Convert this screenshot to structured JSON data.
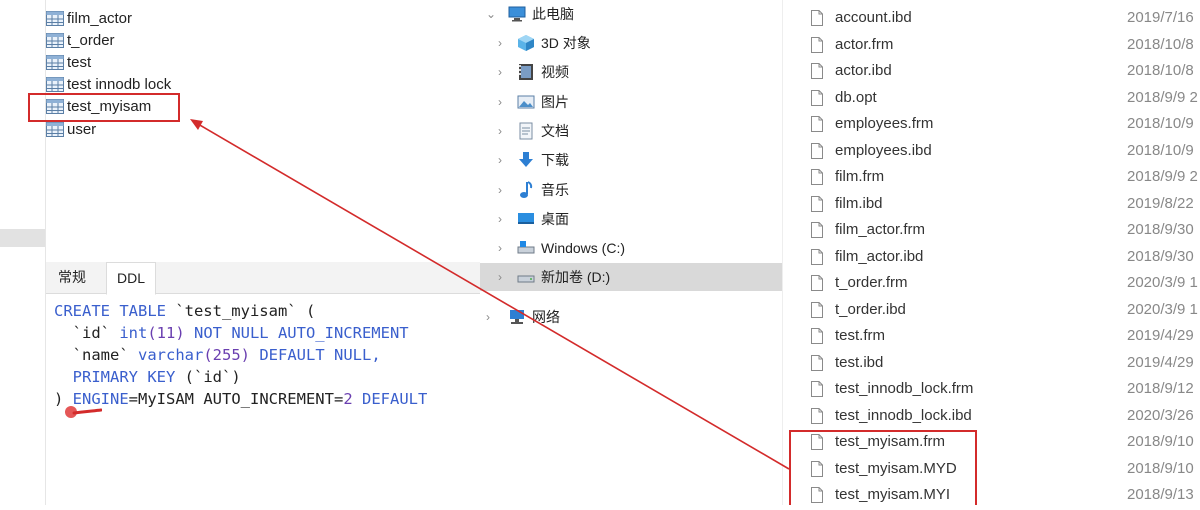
{
  "table_list": {
    "items": [
      {
        "label": "film_actor"
      },
      {
        "label": "t_order"
      },
      {
        "label": "test"
      },
      {
        "label": "test innodb lock"
      },
      {
        "label": "test_myisam"
      },
      {
        "label": "user"
      }
    ]
  },
  "tabs": [
    {
      "label": "常规"
    },
    {
      "label": "DDL"
    }
  ],
  "ddl": {
    "line1_kw": "CREATE TABLE",
    "line1_name": " `test_myisam` (",
    "line2_a": "  `id` ",
    "line2_type": "int",
    "line2_num": "(11)",
    "line2_kw": " NOT NULL AUTO_INCREMENT",
    "line3_a": "  `name` ",
    "line3_type": "varchar",
    "line3_num": "(255)",
    "line3_kw": " DEFAULT NULL,",
    "line4_kw": "  PRIMARY KEY",
    "line4_b": " (`id`)",
    "line5_a": ") ",
    "line5_kw": "ENGINE",
    "line5_b": "=MyISAM AUTO_INCREMENT=",
    "line5_num": "2",
    "line5_c": " DEFAULT"
  },
  "nav": {
    "items": [
      {
        "label": "此电脑",
        "icon": "computer-icon"
      },
      {
        "label": "3D 对象",
        "icon": "cube-icon"
      },
      {
        "label": "视频",
        "icon": "video-icon"
      },
      {
        "label": "图片",
        "icon": "picture-icon"
      },
      {
        "label": "文档",
        "icon": "document-icon"
      },
      {
        "label": "下载",
        "icon": "download-icon"
      },
      {
        "label": "音乐",
        "icon": "music-icon"
      },
      {
        "label": "桌面",
        "icon": "desktop-icon"
      },
      {
        "label": "Windows (C:)",
        "icon": "drive-icon"
      },
      {
        "label": "新加卷 (D:)",
        "icon": "drive-icon"
      },
      {
        "label": "网络",
        "icon": "network-icon"
      }
    ]
  },
  "files": [
    {
      "name": "account.ibd",
      "date": "2019/7/16"
    },
    {
      "name": "actor.frm",
      "date": "2018/10/8"
    },
    {
      "name": "actor.ibd",
      "date": "2018/10/8"
    },
    {
      "name": "db.opt",
      "date": "2018/9/9 2"
    },
    {
      "name": "employees.frm",
      "date": "2018/10/9"
    },
    {
      "name": "employees.ibd",
      "date": "2018/10/9"
    },
    {
      "name": "film.frm",
      "date": "2018/9/9 2"
    },
    {
      "name": "film.ibd",
      "date": "2019/8/22"
    },
    {
      "name": "film_actor.frm",
      "date": "2018/9/30"
    },
    {
      "name": "film_actor.ibd",
      "date": "2018/9/30"
    },
    {
      "name": "t_order.frm",
      "date": "2020/3/9 1"
    },
    {
      "name": "t_order.ibd",
      "date": "2020/3/9 1"
    },
    {
      "name": "test.frm",
      "date": "2019/4/29"
    },
    {
      "name": "test.ibd",
      "date": "2019/4/29"
    },
    {
      "name": "test_innodb_lock.frm",
      "date": "2018/9/12"
    },
    {
      "name": "test_innodb_lock.ibd",
      "date": "2020/3/26"
    },
    {
      "name": "test_myisam.frm",
      "date": "2018/9/10"
    },
    {
      "name": "test_myisam.MYD",
      "date": "2018/9/10"
    },
    {
      "name": "test_myisam.MYI",
      "date": "2018/9/13"
    }
  ],
  "colors": {
    "annotation": "#d32b2b",
    "sql_keyword": "#3a5fcd",
    "sql_number": "#6a3fb0",
    "nav_selected": "#d9d9d9"
  }
}
